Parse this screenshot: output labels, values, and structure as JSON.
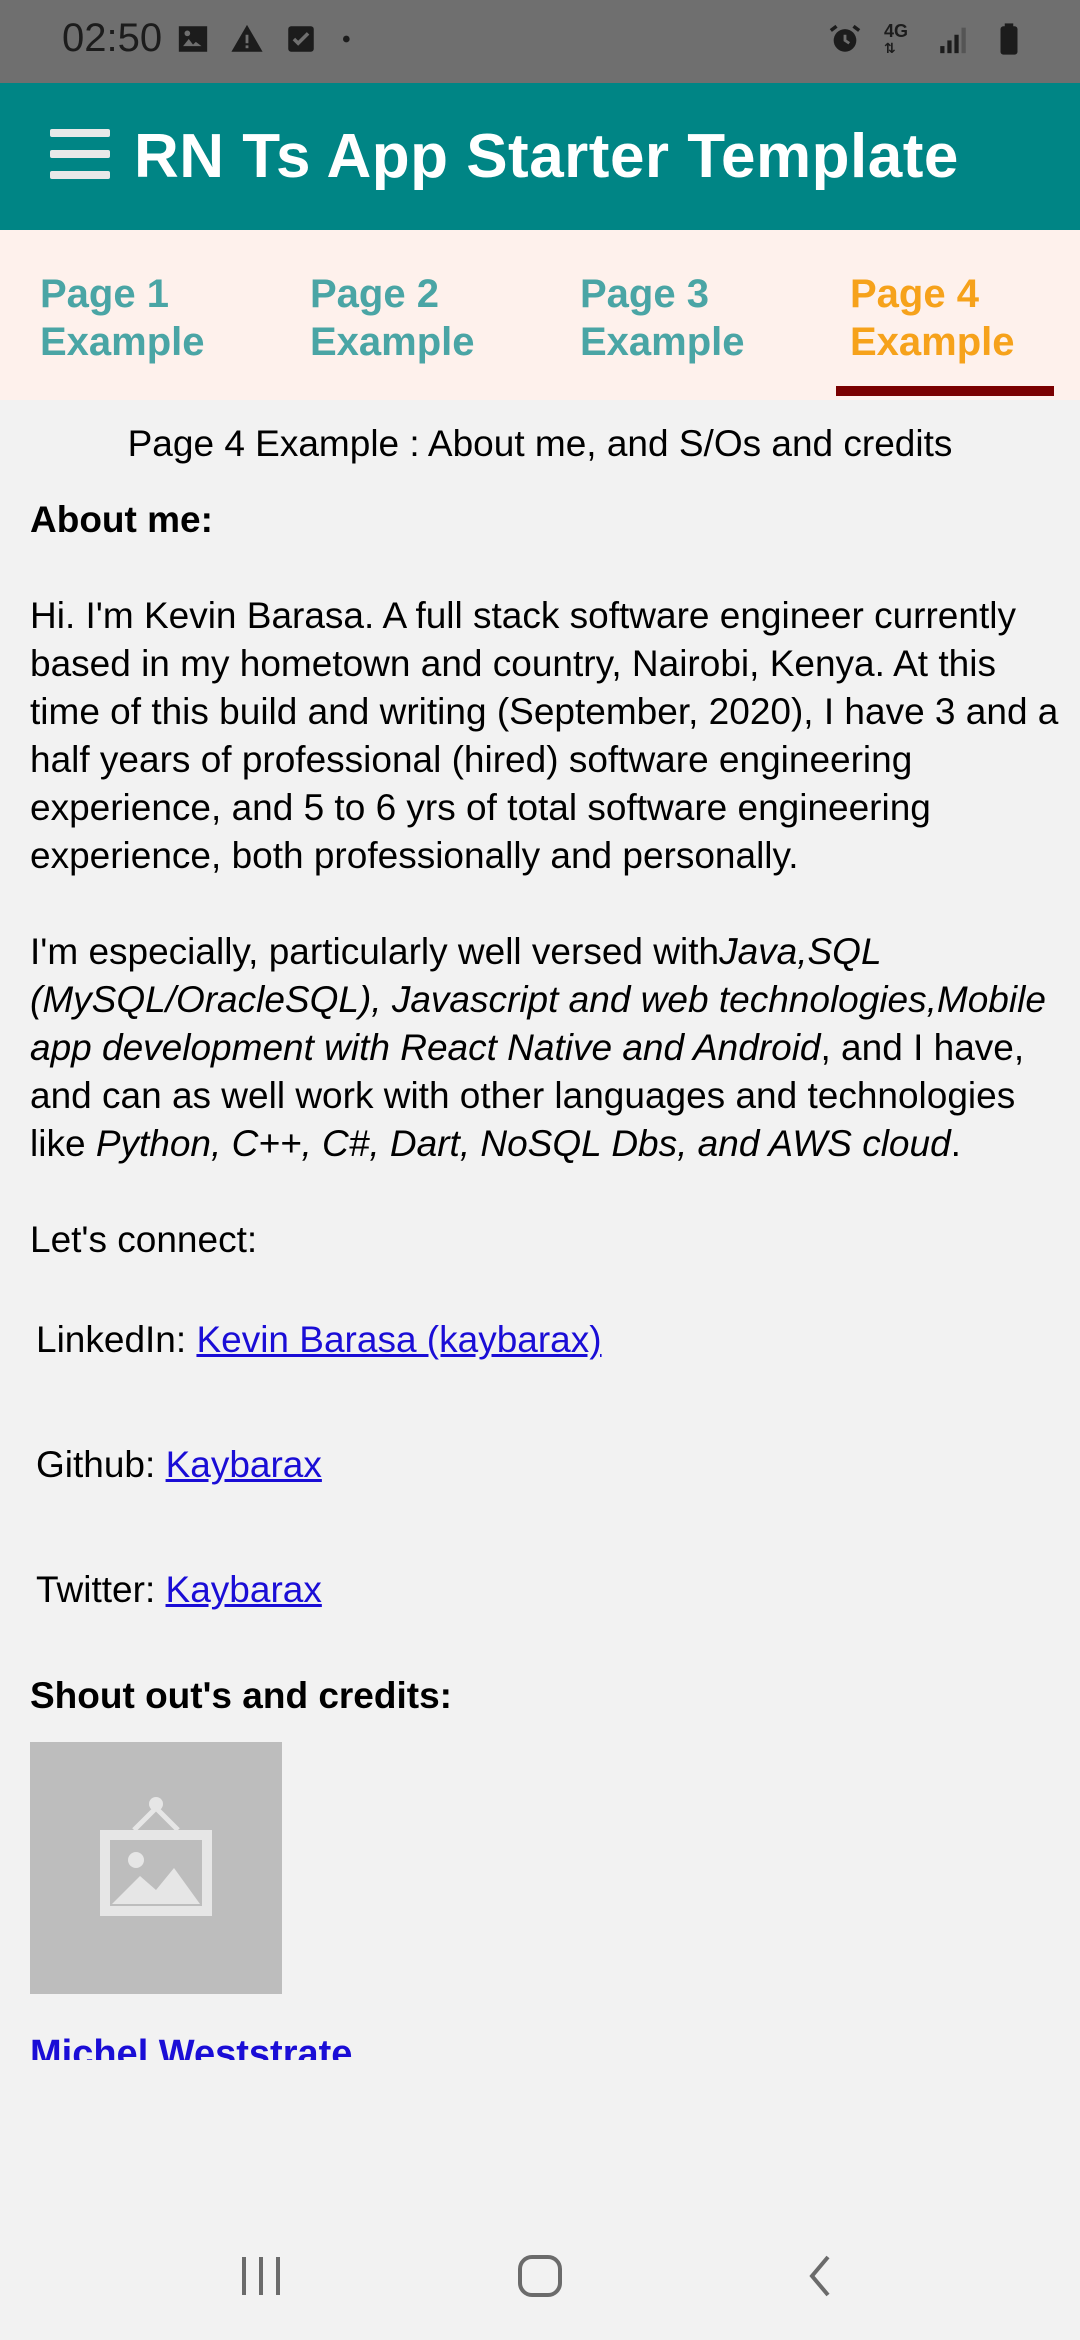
{
  "status_bar": {
    "time": "02:50",
    "left_icons": [
      "image-icon",
      "warning-icon",
      "checkbox-icon",
      "dot-icon"
    ],
    "right_icons": [
      "alarm-icon",
      "network-4g-icon",
      "signal-icon",
      "battery-icon"
    ],
    "network_label": "4G"
  },
  "app_bar": {
    "title": "RN Ts App Starter Template",
    "menu_icon": "hamburger-menu-icon",
    "background": "#008585"
  },
  "tabs": [
    {
      "line1": "Page 1",
      "line2": "Example",
      "active": false
    },
    {
      "line1": "Page 2",
      "line2": "Example",
      "active": false
    },
    {
      "line1": "Page 3",
      "line2": "Example",
      "active": false
    },
    {
      "line1": "Page 4",
      "line2": "Example",
      "active": true
    }
  ],
  "colors": {
    "tab_inactive": "#4aa5a5",
    "tab_active": "#f6a21b",
    "tab_indicator": "#7a0000",
    "link": "#1a0dd6"
  },
  "content": {
    "heading": "Page 4 Example : About me, and S/Os and credits",
    "about_title": "About me:",
    "about_para": "Hi. I'm Kevin Barasa. A full stack software engineer currently based in my hometown and  country, Nairobi, Kenya. At this time of this build and writing (September, 2020), I have 3 and a half years of professional (hired) software engineering experience, and 5 to 6 yrs of total software engineering experience, both professionally and personally.",
    "skills_intro": "I'm especially, particularly well versed with",
    "skills_main": "Java,SQL (MySQL/OracleSQL), Javascript and web technologies,Mobile app development with React Native and Android",
    "skills_mid": ",  and I have, and can as well work with other languages and technologies like ",
    "skills_other": "Python, C++, C#, Dart, NoSQL Dbs, and AWS cloud",
    "skills_end": ".",
    "connect_label": "Let's connect:",
    "socials": [
      {
        "label": "LinkedIn: ",
        "link": "Kevin Barasa (kaybarax)"
      },
      {
        "label": "Github: ",
        "link": "Kaybarax"
      },
      {
        "label": "Twitter: ",
        "link": "Kaybarax"
      }
    ],
    "credits_title": "Shout out's and credits:",
    "credit_image_icon": "image-placeholder-icon",
    "credit_name": "Michel Weststrate"
  },
  "nav_bar": {
    "buttons": [
      "recent-apps-icon",
      "home-icon",
      "back-icon"
    ]
  }
}
